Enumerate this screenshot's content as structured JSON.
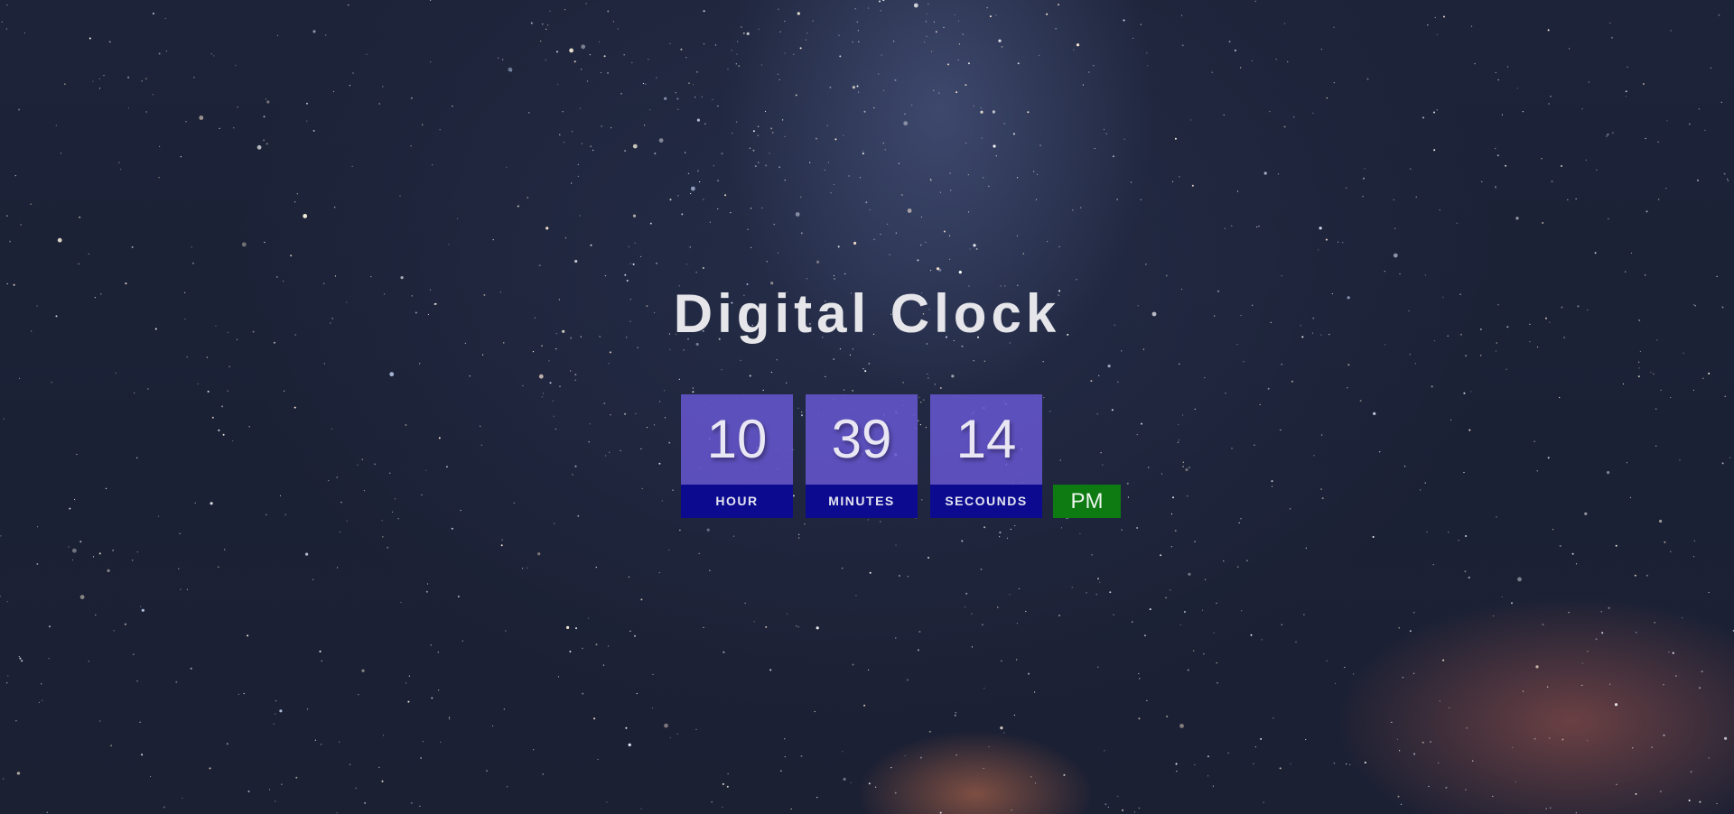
{
  "title": "Digital Clock",
  "clock": {
    "hour": {
      "value": "10",
      "label": "HOUR"
    },
    "minutes": {
      "value": "39",
      "label": "MINUTES"
    },
    "seconds": {
      "value": "14",
      "label": "SECOUNDS"
    },
    "period": "PM"
  },
  "colors": {
    "digit_box": "#6455cd",
    "label_box": "#0c0b8f",
    "period_box": "#0d7a12",
    "title_text": "#e6e6ea",
    "background": "#1d2338"
  }
}
